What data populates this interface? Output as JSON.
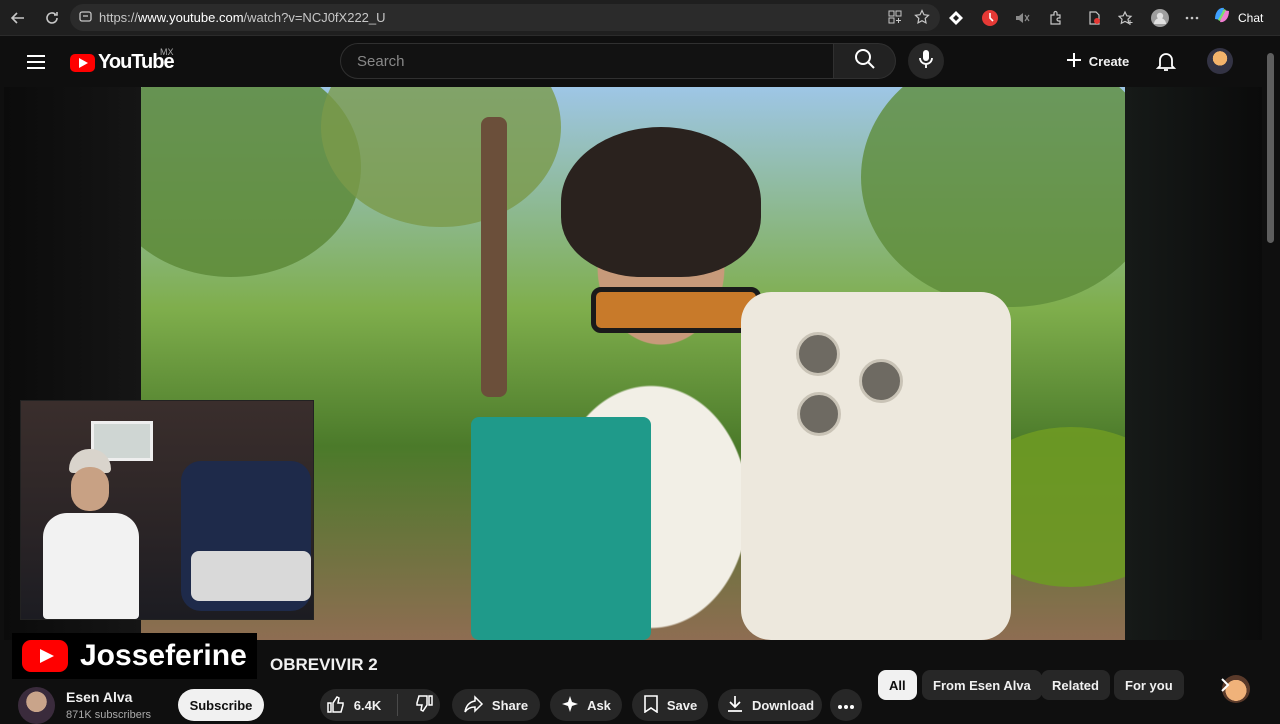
{
  "browser": {
    "url_prefix": "https://",
    "url_host": "www.youtube.com",
    "url_path": "/watch?v=NCJ0fX222_U",
    "chat_label": "Chat"
  },
  "header": {
    "logo_text": "YouTube",
    "country": "MX",
    "search_placeholder": "Search",
    "create_label": "Create"
  },
  "overlay": {
    "channel_name": "Josseferine"
  },
  "video": {
    "title_visible": "OBREVIVIR 2"
  },
  "channel": {
    "name": "Esen Alva",
    "subscribers": "871K subscribers",
    "subscribe_label": "Subscribe"
  },
  "actions": {
    "like_count": "6.4K",
    "share_label": "Share",
    "ask_label": "Ask",
    "save_label": "Save",
    "download_label": "Download"
  },
  "chips": [
    "All",
    "From Esen Alva",
    "Related",
    "For you"
  ],
  "colors": {
    "accent": "#ff0000",
    "background": "#0f0f0f",
    "pill": "#272727"
  }
}
